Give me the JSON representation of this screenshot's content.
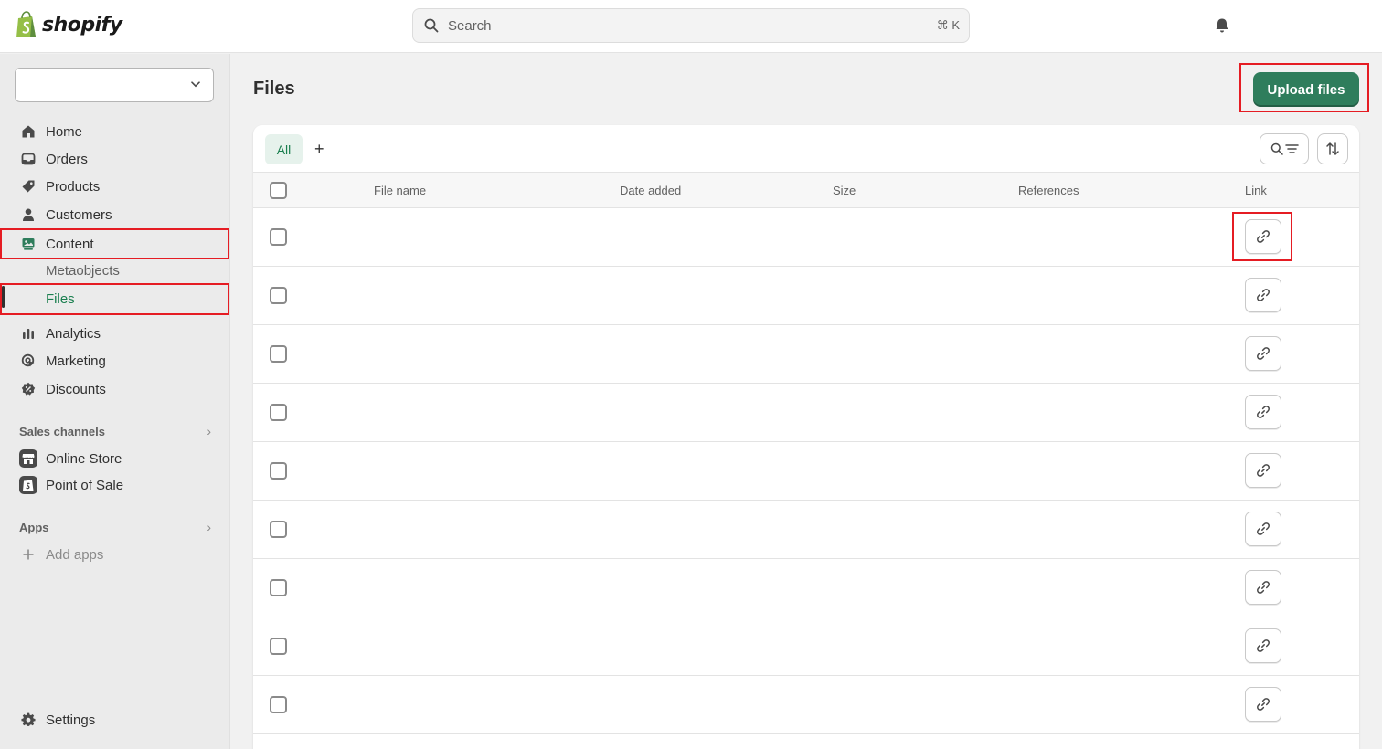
{
  "topbar": {
    "logo_text": "shopify",
    "search_placeholder": "Search",
    "search_shortcut": "⌘ K"
  },
  "sidebar": {
    "store_selector_value": "",
    "main_items": [
      {
        "label": "Home",
        "icon": "home-icon"
      },
      {
        "label": "Orders",
        "icon": "orders-icon"
      },
      {
        "label": "Products",
        "icon": "tag-icon"
      },
      {
        "label": "Customers",
        "icon": "person-icon"
      },
      {
        "label": "Content",
        "icon": "content-icon"
      }
    ],
    "content_sub_items": [
      {
        "label": "Metaobjects"
      },
      {
        "label": "Files",
        "active": true
      }
    ],
    "more_items": [
      {
        "label": "Analytics",
        "icon": "analytics-icon"
      },
      {
        "label": "Marketing",
        "icon": "marketing-icon"
      },
      {
        "label": "Discounts",
        "icon": "discount-icon"
      }
    ],
    "sales_channels": {
      "title": "Sales channels",
      "items": [
        {
          "label": "Online Store",
          "icon": "online-store-icon"
        },
        {
          "label": "Point of Sale",
          "icon": "point-of-sale-icon"
        }
      ]
    },
    "apps": {
      "title": "Apps",
      "add_label": "Add apps"
    },
    "settings_label": "Settings"
  },
  "main": {
    "page_title": "Files",
    "upload_label": "Upload files",
    "tabs": [
      {
        "label": "All",
        "selected": true
      }
    ],
    "add_tab_label": "+",
    "columns": [
      "File name",
      "Date added",
      "Size",
      "References",
      "Link"
    ],
    "row_count": 9
  },
  "colors": {
    "primary_button": "#2f7d5c",
    "active_nav_text": "#1a7f4f",
    "highlight_box": "#e51c23"
  }
}
